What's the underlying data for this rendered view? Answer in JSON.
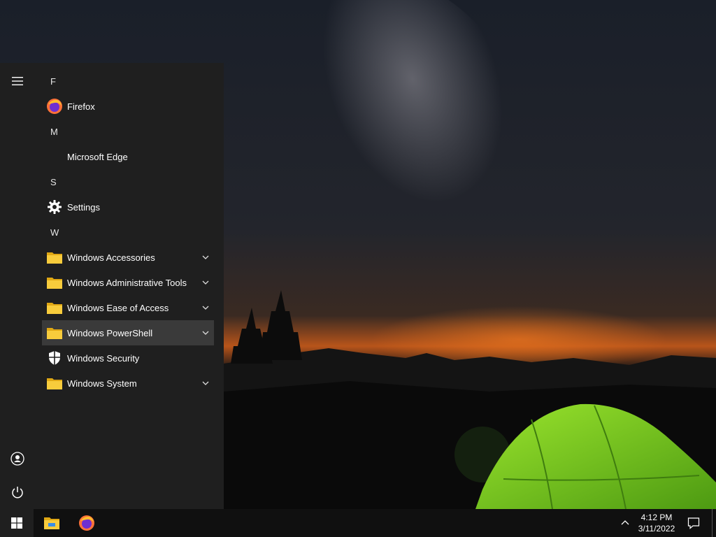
{
  "start_menu": {
    "groups": [
      {
        "letter": "F",
        "apps": [
          {
            "label": "Firefox",
            "icon": "firefox-icon",
            "expandable": false
          }
        ]
      },
      {
        "letter": "M",
        "apps": [
          {
            "label": "Microsoft Edge",
            "icon": "",
            "expandable": false
          }
        ]
      },
      {
        "letter": "S",
        "apps": [
          {
            "label": "Settings",
            "icon": "gear-icon",
            "expandable": false
          }
        ]
      },
      {
        "letter": "W",
        "apps": [
          {
            "label": "Windows Accessories",
            "icon": "folder-icon",
            "expandable": true
          },
          {
            "label": "Windows Administrative Tools",
            "icon": "folder-icon",
            "expandable": true
          },
          {
            "label": "Windows Ease of Access",
            "icon": "folder-icon",
            "expandable": true
          },
          {
            "label": "Windows PowerShell",
            "icon": "folder-icon",
            "expandable": true,
            "highlighted": true
          },
          {
            "label": "Windows Security",
            "icon": "shield-icon",
            "expandable": false
          },
          {
            "label": "Windows System",
            "icon": "folder-icon",
            "expandable": true
          }
        ]
      }
    ]
  },
  "taskbar": {
    "time": "4:12 PM",
    "date": "3/11/2022"
  },
  "colors": {
    "menu_bg": "#1f1f1f",
    "taskbar_bg": "#101010",
    "highlight": "#3a3a3a",
    "folder_yellow": "#f5c518",
    "tent_green": "#7ed321"
  }
}
